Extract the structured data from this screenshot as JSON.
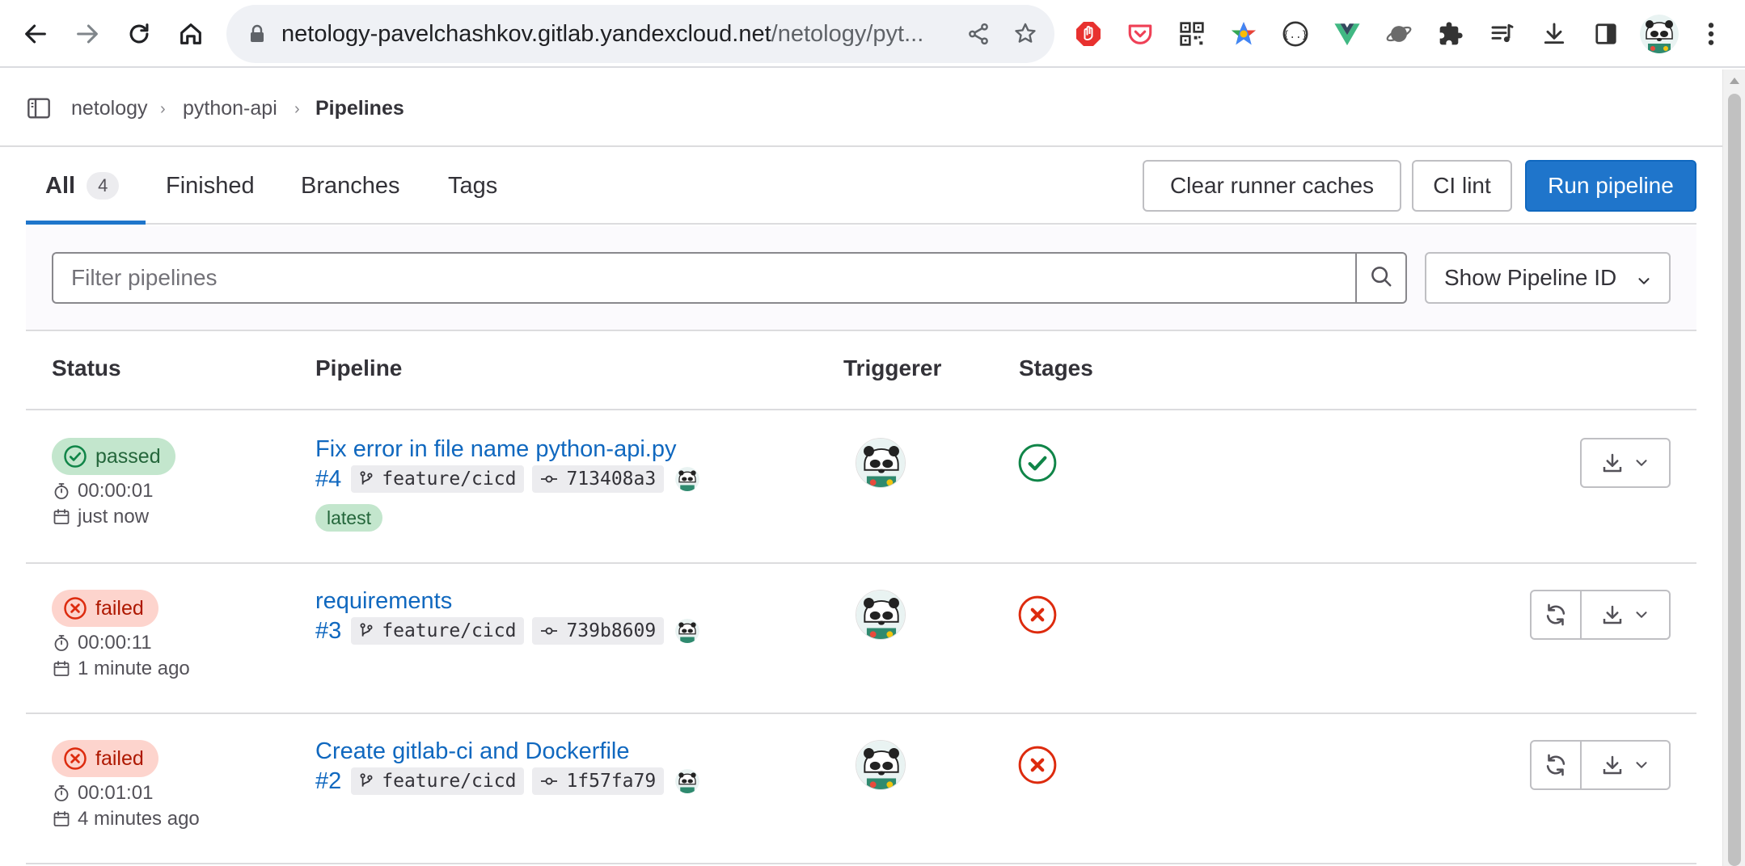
{
  "browser": {
    "url_host": "netology-pavelchashkov.gitlab.yandexcloud.net",
    "url_path": "/netology/pyt..."
  },
  "breadcrumb": {
    "items": [
      "netology",
      "python-api",
      "Pipelines"
    ],
    "separator": "›"
  },
  "tabs": [
    {
      "label": "All",
      "count": "4"
    },
    {
      "label": "Finished"
    },
    {
      "label": "Branches"
    },
    {
      "label": "Tags"
    }
  ],
  "actions": {
    "clear_caches": "Clear runner caches",
    "ci_lint": "CI lint",
    "run_pipeline": "Run pipeline"
  },
  "filter": {
    "placeholder": "Filter pipelines",
    "dropdown_label": "Show Pipeline ID"
  },
  "table": {
    "headers": {
      "status": "Status",
      "pipeline": "Pipeline",
      "triggerer": "Triggerer",
      "stages": "Stages"
    },
    "rows": [
      {
        "status": "passed",
        "duration": "00:00:01",
        "finished": "just now",
        "title": "Fix error in file name python-api.py",
        "id": "#4",
        "branch": "feature/cicd",
        "commit": "713408a3",
        "badge": "latest"
      },
      {
        "status": "failed",
        "duration": "00:00:11",
        "finished": "1 minute ago",
        "title": "requirements",
        "id": "#3",
        "branch": "feature/cicd",
        "commit": "739b8609"
      },
      {
        "status": "failed",
        "duration": "00:01:01",
        "finished": "4 minutes ago",
        "title": "Create gitlab-ci and Dockerfile",
        "id": "#2",
        "branch": "feature/cicd",
        "commit": "1f57fa79"
      }
    ]
  },
  "colors": {
    "primary": "#1f75cb",
    "link": "#1068bf",
    "success": "#108548",
    "danger": "#dd2b0e"
  },
  "icons": {
    "back": "arrow-left-icon",
    "forward": "arrow-right-icon",
    "reload": "reload-icon",
    "home": "home-icon",
    "search": "search-icon",
    "branch": "branch-icon",
    "commit": "commit-icon",
    "download": "download-icon",
    "retry": "retry-icon"
  }
}
